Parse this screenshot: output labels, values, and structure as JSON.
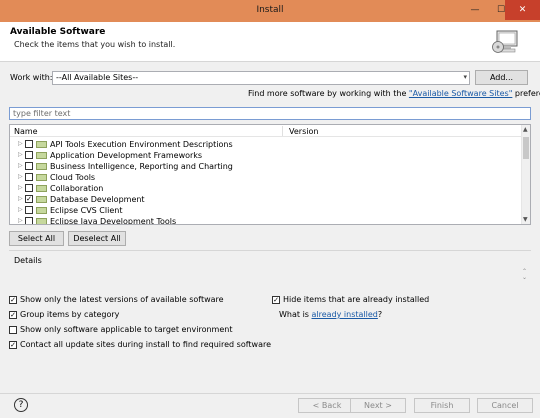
{
  "window": {
    "title": "Install",
    "minimize_glyph": "—",
    "maximize_glyph": "☐",
    "close_glyph": "✕"
  },
  "header": {
    "title": "Available Software",
    "subtitle": "Check the items that you wish to install."
  },
  "work_with": {
    "label": "Work with:",
    "value": "--All Available Sites--",
    "add_button": "Add...",
    "hint_prefix": "Find more software by working with the ",
    "hint_link": "\"Available Software Sites\"",
    "hint_suffix": " preferences."
  },
  "filter": {
    "placeholder": "type filter text"
  },
  "table": {
    "columns": [
      "Name",
      "Version"
    ],
    "rows": [
      {
        "name": "API Tools Execution Environment Descriptions",
        "checked": false
      },
      {
        "name": "Application Development Frameworks",
        "checked": false
      },
      {
        "name": "Business Intelligence, Reporting and Charting",
        "checked": false
      },
      {
        "name": "Cloud Tools",
        "checked": false
      },
      {
        "name": "Collaboration",
        "checked": false
      },
      {
        "name": "Database Development",
        "checked": true
      },
      {
        "name": "Eclipse CVS Client",
        "checked": false
      },
      {
        "name": "Eclipse Java Development Tools",
        "checked": false
      }
    ]
  },
  "selection_buttons": {
    "select_all": "Select All",
    "deselect_all": "Deselect All"
  },
  "details": {
    "label": "Details"
  },
  "options": {
    "latest_versions": {
      "label": "Show only the latest versions of available software",
      "checked": true
    },
    "hide_installed": {
      "label": "Hide items that are already installed",
      "checked": true
    },
    "group_by_category": {
      "label": "Group items by category",
      "checked": true
    },
    "what_is_prefix": "What is ",
    "already_installed_link": "already installed",
    "what_is_suffix": "?",
    "target_env": {
      "label": "Show only software applicable to target environment",
      "checked": false
    },
    "contact_sites": {
      "label": "Contact all update sites during install to find required software",
      "checked": true
    }
  },
  "footer": {
    "help_glyph": "?",
    "back": "< Back",
    "next": "Next >",
    "finish": "Finish",
    "cancel": "Cancel"
  },
  "colors": {
    "titlebar": "#e28b57",
    "close": "#c7402b",
    "link": "#1a5aa6"
  }
}
